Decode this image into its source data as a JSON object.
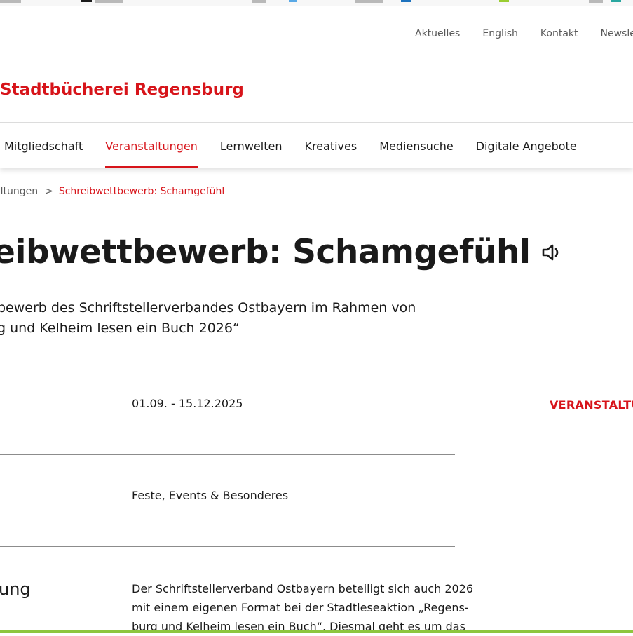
{
  "service_nav": {
    "items": [
      "Aktuelles",
      "English",
      "Kontakt",
      "Newslette"
    ]
  },
  "site": {
    "logo_text": "Stadtbücherei Regensburg"
  },
  "main_nav": {
    "items": [
      "Mitgliedschaft",
      "Veranstaltungen",
      "Lernwelten",
      "Kreatives",
      "Mediensuche",
      "Digitale Angebote"
    ],
    "active": "Veranstaltungen"
  },
  "breadcrumb": {
    "parent": "altungen",
    "separator": ">",
    "current": "Schreibwettbewerb: Schamgefühl"
  },
  "event": {
    "title": "eibwettbewerb: Schamgefühl",
    "subtitle_lines": [
      "bewerb des Schriftstellerverbandes Ostbayern im Rahmen von",
      "g und Kelheim lesen ein Buch 2026“"
    ],
    "date": "01.09. - 15.12.2025",
    "category": "Feste, Events & Besonderes",
    "description_label": "ung",
    "description_lines": [
      "Der Schriftstellerverband Ostbayern beteiligt sich auch 2026",
      "mit einem eigenen Format bei der Stadtleseaktion „Regens-",
      "burg und Kelheim lesen ein Buch“. Diesmal geht es um das"
    ]
  },
  "sidebar": {
    "heading": "VERANSTALTU"
  },
  "icons": {
    "speaker": "speaker-icon"
  },
  "colors": {
    "accent": "#d7141a",
    "text": "#1a1a1a",
    "muted": "#595959",
    "rule": "#8c8c8c",
    "bottom_bar": "#8dc63f"
  }
}
